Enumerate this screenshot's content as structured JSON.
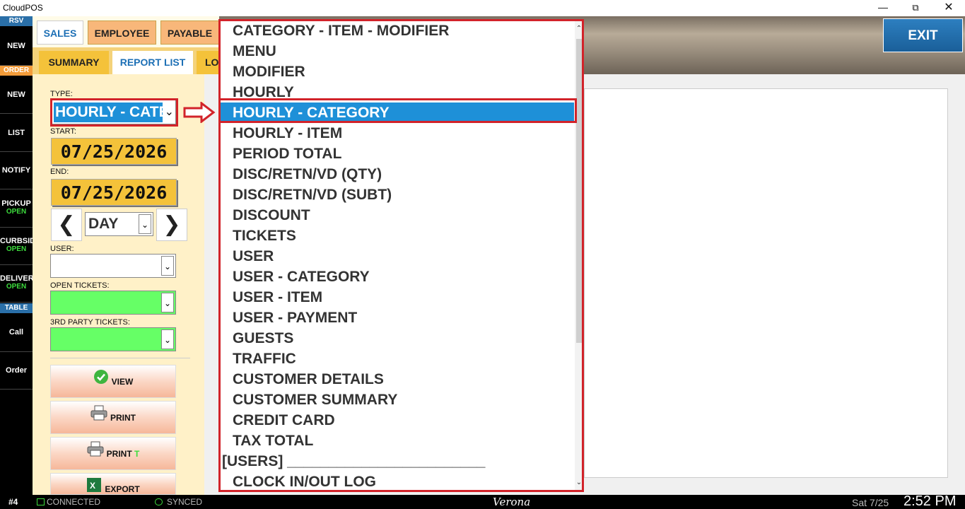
{
  "window": {
    "title": "CloudPOS",
    "min": "—",
    "max": "⧉",
    "close": "✕"
  },
  "sidebar": {
    "rsv_header": "RSV",
    "rsv_new": "NEW",
    "order_header": "ORDER",
    "order_new": "NEW",
    "list": "LIST",
    "notify": "NOTIFY",
    "pickup": {
      "label": "PICKUP",
      "status": "OPEN"
    },
    "curbside": {
      "label": "CURBSID",
      "status": "OPEN"
    },
    "delivery": {
      "label": "DELIVER",
      "status": "OPEN"
    },
    "table_header": "TABLE",
    "call": "Call",
    "order": "Order"
  },
  "tabs": {
    "sales": "SALES",
    "employee": "EMPLOYEE",
    "payable": "PAYABLE"
  },
  "subtabs": {
    "summary": "SUMMARY",
    "report_list": "REPORT LIST",
    "lo": "LO"
  },
  "exit_label": "EXIT",
  "form": {
    "type_label": "TYPE:",
    "type_value": "HOURLY - CATE",
    "start_label": "START:",
    "start_date": "07/25/2026",
    "end_label": "END:",
    "end_date": "07/25/2026",
    "prev_arrow": "❮",
    "next_arrow": "❯",
    "period_value": "DAY",
    "user_label": "USER:",
    "open_tickets_label": "OPEN TICKETS:",
    "third_party_label": "3RD PARTY TICKETS:",
    "open_tickets_color": "#66ff66",
    "third_party_color": "#66ff66"
  },
  "actions": {
    "view": "VIEW",
    "print": "PRINT",
    "print_t": "PRINT",
    "print_t_suffix": "T",
    "export": "EXPORT"
  },
  "dropdown": {
    "items": [
      "CATEGORY - ITEM - MODIFIER",
      "MENU",
      "MODIFIER",
      "HOURLY",
      "HOURLY - CATEGORY",
      "HOURLY - ITEM",
      "PERIOD TOTAL",
      "DISC/RETN/VD (QTY)",
      "DISC/RETN/VD (SUBT)",
      "DISCOUNT",
      "TICKETS",
      "USER",
      "USER - CATEGORY",
      "USER - ITEM",
      "USER - PAYMENT",
      "GUESTS",
      "TRAFFIC",
      "CUSTOMER DETAILS",
      "CUSTOMER SUMMARY",
      "CREDIT CARD",
      "TAX TOTAL",
      "[USERS] ________________________",
      "CLOCK IN/OUT LOG"
    ],
    "selected_index": 4,
    "scroll_up": "⌃",
    "scroll_down": "⌄"
  },
  "status": {
    "station": "#4",
    "connection": "CONNECTED",
    "sync": "SYNCED",
    "location": "Verona",
    "date": "Sat 7/25",
    "time": "2:52 PM"
  },
  "colors": {
    "accent_blue": "#1e90d8",
    "highlight_red": "#d2232a",
    "date_yellow": "#f4c23a"
  }
}
